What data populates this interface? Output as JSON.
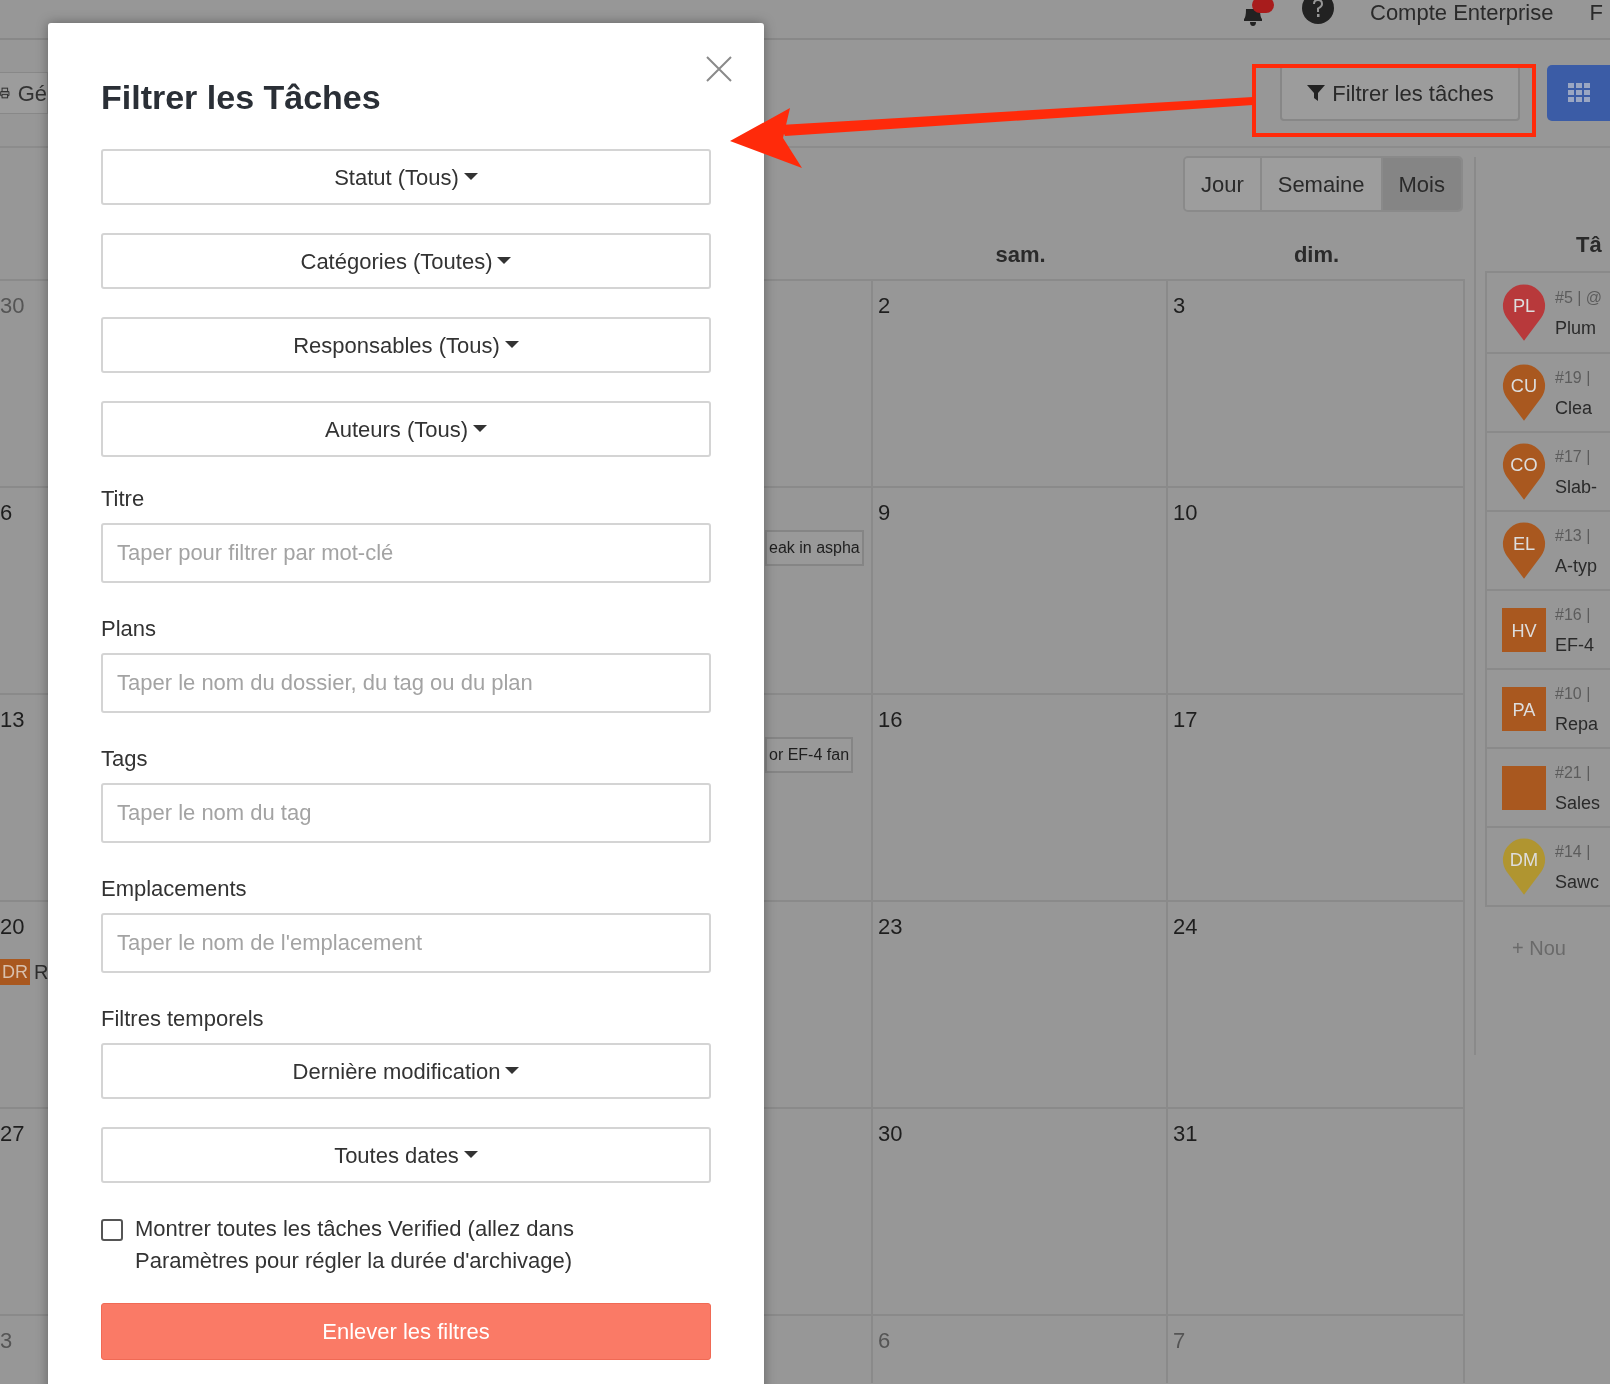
{
  "top_bar": {
    "account": "Compte Enterprise",
    "next_item": "F"
  },
  "toolbar": {
    "left_button": "Gé",
    "filter_button": "Filtrer les tâches"
  },
  "view_tabs": [
    {
      "label": "Jour",
      "selected": false
    },
    {
      "label": "Semaine",
      "selected": false
    },
    {
      "label": "Mois",
      "selected": true
    }
  ],
  "calendar": {
    "weekdays": [
      "sam.",
      "dim."
    ],
    "weeks": [
      {
        "left_day": "30",
        "left_muted": true,
        "days": [
          {
            "day": "2",
            "muted": false
          },
          {
            "day": "3",
            "muted": false
          }
        ]
      },
      {
        "left_day": "6",
        "left_muted": false,
        "chip": "eak in aspha",
        "days": [
          {
            "day": "9",
            "muted": false
          },
          {
            "day": "10",
            "muted": false
          }
        ]
      },
      {
        "left_day": "13",
        "left_muted": false,
        "chip": "or EF-4 fan",
        "days": [
          {
            "day": "16",
            "muted": false
          },
          {
            "day": "17",
            "muted": false
          }
        ]
      },
      {
        "left_day": "20",
        "left_muted": false,
        "left_badge": "DR",
        "left_text": "R",
        "days": [
          {
            "day": "23",
            "muted": false
          },
          {
            "day": "24",
            "muted": false
          }
        ]
      },
      {
        "left_day": "27",
        "left_muted": false,
        "days": [
          {
            "day": "30",
            "muted": false
          },
          {
            "day": "31",
            "muted": false
          }
        ]
      },
      {
        "left_day": "3",
        "left_muted": true,
        "days": [
          {
            "day": "6",
            "muted": true
          },
          {
            "day": "7",
            "muted": true
          }
        ]
      }
    ]
  },
  "tasks_panel": {
    "heading": "Tâ",
    "items": [
      {
        "kind": "pin",
        "initials": "PL",
        "color": "#b8393b",
        "number": "#5 | @",
        "title": "Plum"
      },
      {
        "kind": "pin",
        "initials": "CU",
        "color": "#a9581f",
        "number": "#19 |",
        "title": "Clea"
      },
      {
        "kind": "pin",
        "initials": "CO",
        "color": "#a9581f",
        "number": "#17 |",
        "title": "Slab-"
      },
      {
        "kind": "pin",
        "initials": "EL",
        "color": "#a9581f",
        "number": "#13 |",
        "title": "A-typ"
      },
      {
        "kind": "square",
        "initials": "HV",
        "color": "#a9581f",
        "number": "#16 |",
        "title": "EF-4"
      },
      {
        "kind": "square",
        "initials": "PA",
        "color": "#a9581f",
        "number": "#10 |",
        "title": "Repa"
      },
      {
        "kind": "square",
        "color": "#a9581f",
        "number": "#21 |",
        "title": "Sales"
      },
      {
        "kind": "pin",
        "initials": "DM",
        "color": "#b09530",
        "number": "#14 |",
        "title": "Sawc"
      }
    ],
    "add_link": "+ Nou"
  },
  "modal": {
    "title": "Filtrer les Tâches",
    "dropdowns": [
      "Statut (Tous)",
      "Catégories (Toutes)",
      "Responsables (Tous)",
      "Auteurs (Tous)"
    ],
    "fields": [
      {
        "label": "Titre",
        "placeholder": "Taper pour filtrer par mot-clé"
      },
      {
        "label": "Plans",
        "placeholder": "Taper le nom du dossier, du tag ou du plan"
      },
      {
        "label": "Tags",
        "placeholder": "Taper le nom du tag"
      },
      {
        "label": "Emplacements",
        "placeholder": "Taper le nom de l'emplacement"
      }
    ],
    "time_filters": {
      "label": "Filtres temporels",
      "dropdowns": [
        "Dernière modification",
        "Toutes dates"
      ]
    },
    "checkbox": {
      "label": "Montrer toutes les tâches Verified (allez dans Paramètres pour régler la durée d'archivage)",
      "checked": false
    },
    "clear_button": "Enlever les filtres"
  }
}
